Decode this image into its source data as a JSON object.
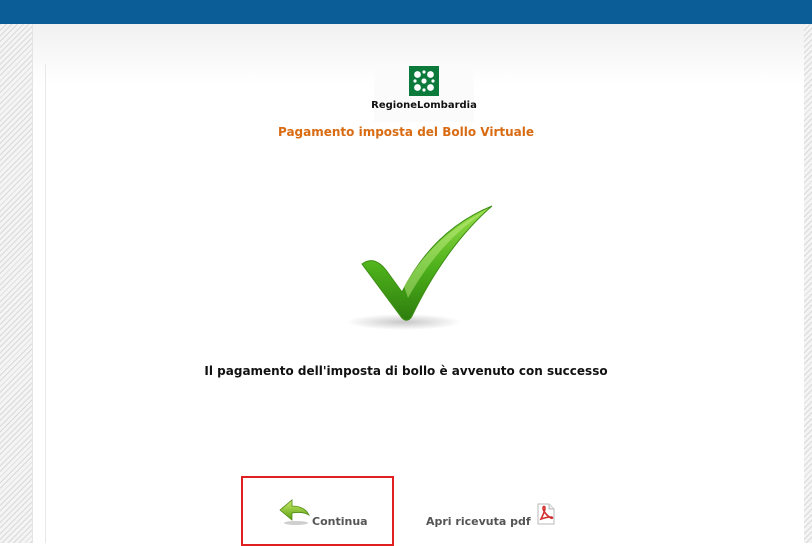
{
  "brand": {
    "logo_text": "RegioneLombardia",
    "service_title": "Pagamento imposta del Bollo Virtuale"
  },
  "result": {
    "message": "Il pagamento dell'imposta di bollo è avvenuto con successo"
  },
  "actions": {
    "continue_label": "Continua",
    "receipt_label": "Apri ricevuta pdf"
  },
  "colors": {
    "topbar": "#0a5d96",
    "title": "#d96b12",
    "check": "#4caf1a",
    "highlight": "#e02020",
    "logo": "#0b7a3a"
  },
  "icons": {
    "success": "checkmark-icon",
    "continue": "back-arrow-icon",
    "receipt": "pdf-icon"
  }
}
